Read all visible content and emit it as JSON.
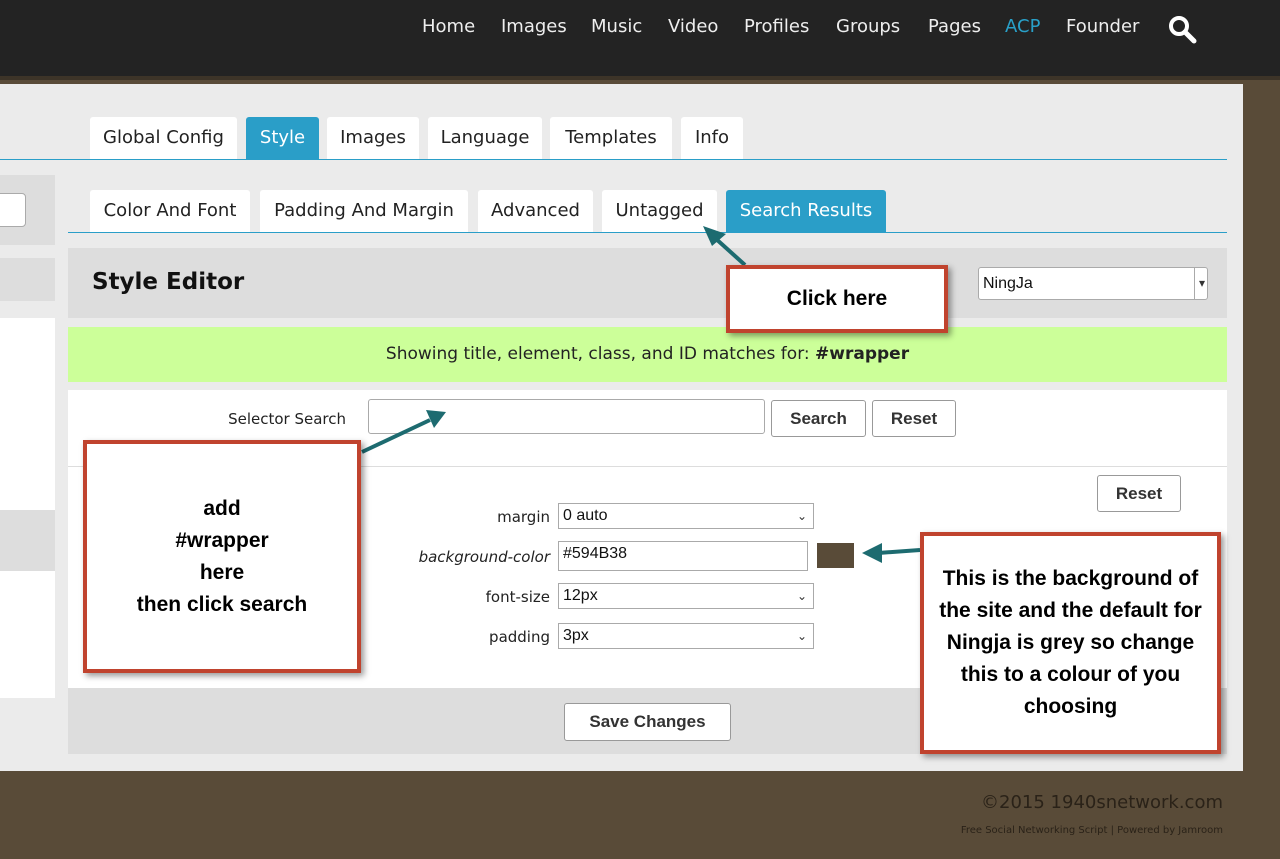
{
  "nav": {
    "items": [
      "Home",
      "Images",
      "Music",
      "Video",
      "Profiles",
      "Groups",
      "Pages",
      "ACP",
      "Founder"
    ],
    "active": "ACP"
  },
  "tabs": [
    "Global Config",
    "Style",
    "Images",
    "Language",
    "Templates",
    "Info"
  ],
  "subtabs": [
    "Color And Font",
    "Padding And Margin",
    "Advanced",
    "Untagged",
    "Search Results"
  ],
  "editor": {
    "title": "Style Editor",
    "skin": "NingJa",
    "notice_prefix": "Showing title, element, class, and ID matches for: ",
    "notice_term": "#wrapper",
    "selector_label": "Selector Search",
    "selector_value": "",
    "search": "Search",
    "reset": "Reset",
    "reset2": "Reset",
    "fields": [
      {
        "label": "margin",
        "value": "0 auto"
      },
      {
        "label": "background-color",
        "value": "#594B38"
      },
      {
        "label": "font-size",
        "value": "12px"
      },
      {
        "label": "padding",
        "value": "3px"
      }
    ],
    "swatch": "#594B38",
    "save": "Save Changes"
  },
  "notes": {
    "click": "Click here",
    "add": [
      "add",
      "#wrapper",
      "here",
      "then click search"
    ],
    "bg": "This is the background of the site and the default for Ningja is grey so change this to a colour of you choosing"
  },
  "footer": {
    "copyright": "©2015 1940snetwork.com",
    "powered": "Free Social Networking Script | Powered by Jamroom"
  }
}
